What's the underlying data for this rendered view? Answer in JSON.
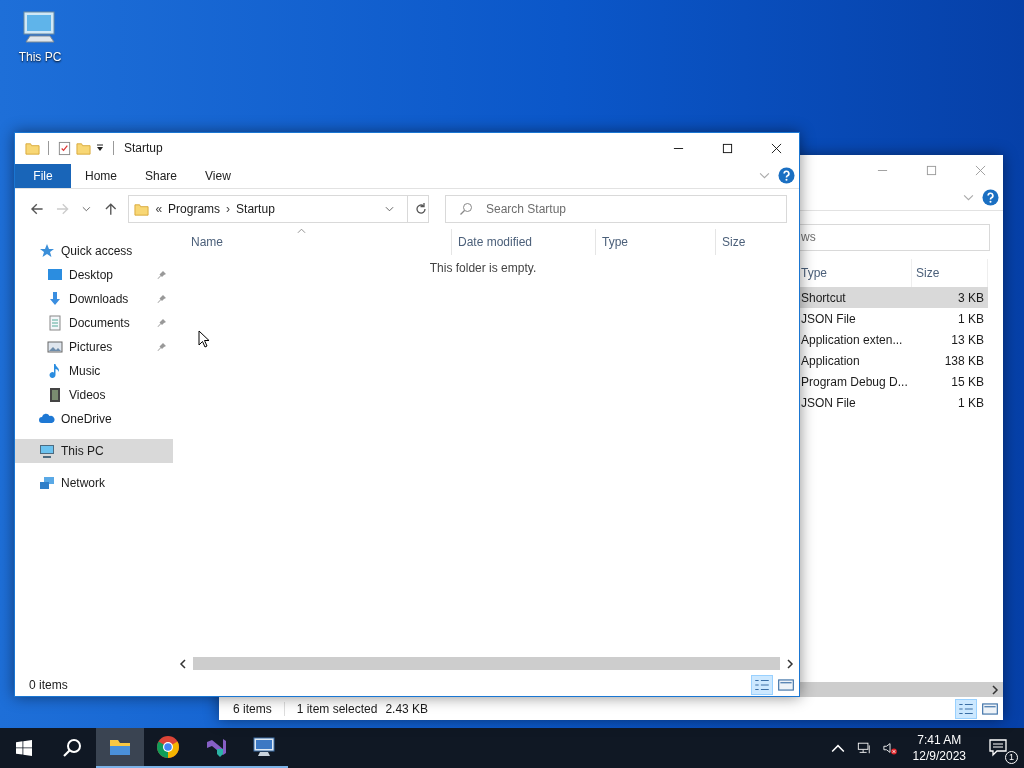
{
  "desktop_icons": [
    {
      "label": "This PC"
    }
  ],
  "back_window": {
    "search": {
      "placeholder": "ws"
    },
    "columns": [
      "Type",
      "Size"
    ],
    "rows": [
      {
        "type": "Shortcut",
        "size": "3 KB",
        "selected": true
      },
      {
        "type": "JSON File",
        "size": "1 KB",
        "selected": false
      },
      {
        "type": "Application exten...",
        "size": "13 KB",
        "selected": false
      },
      {
        "type": "Application",
        "size": "138 KB",
        "selected": false
      },
      {
        "type": "Program Debug D...",
        "size": "15 KB",
        "selected": false
      },
      {
        "type": "JSON File",
        "size": "1 KB",
        "selected": false
      }
    ],
    "status_bar": {
      "item_count": "6 items",
      "selection": "1 item selected",
      "selection_size": "2.43 KB"
    }
  },
  "front_window": {
    "title": "Startup",
    "ribbon_tabs": [
      {
        "label": "File",
        "kind": "file"
      },
      {
        "label": "Home",
        "kind": "tab"
      },
      {
        "label": "Share",
        "kind": "tab"
      },
      {
        "label": "View",
        "kind": "tab"
      }
    ],
    "address": {
      "overflow": "«",
      "separator": "›",
      "segments": [
        "Programs",
        "Startup"
      ]
    },
    "search": {
      "placeholder": "Search Startup"
    },
    "nav_pane": [
      {
        "label": "Quick access",
        "kind": "star",
        "selected": false,
        "children": [
          {
            "label": "Desktop",
            "kind": "desktop",
            "pinned": true,
            "selected": false
          },
          {
            "label": "Downloads",
            "kind": "download",
            "pinned": true,
            "selected": false
          },
          {
            "label": "Documents",
            "kind": "document",
            "pinned": true,
            "selected": false
          },
          {
            "label": "Pictures",
            "kind": "picture",
            "pinned": true,
            "selected": false
          },
          {
            "label": "Music",
            "kind": "music",
            "pinned": false,
            "selected": false
          },
          {
            "label": "Videos",
            "kind": "video",
            "pinned": false,
            "selected": false
          }
        ]
      },
      {
        "label": "OneDrive",
        "kind": "cloud",
        "selected": false
      },
      {
        "label": "This PC",
        "kind": "computer",
        "selected": true
      },
      {
        "label": "Network",
        "kind": "network",
        "selected": false
      }
    ],
    "columns": [
      {
        "label": "Name",
        "sorted": true
      },
      {
        "label": "Date modified",
        "sorted": false
      },
      {
        "label": "Type",
        "sorted": false
      },
      {
        "label": "Size",
        "sorted": false
      }
    ],
    "empty_message": "This folder is empty.",
    "status_bar": {
      "item_count": "0 items"
    }
  },
  "taskbar": {
    "apps": [
      {
        "kind": "explorer",
        "active": true
      },
      {
        "kind": "chrome",
        "active": false
      },
      {
        "kind": "visual_studio",
        "active": false
      },
      {
        "kind": "remote_desktop",
        "active": false
      }
    ],
    "time": "7:41 AM",
    "date": "12/9/2023",
    "notification_count": "1"
  }
}
